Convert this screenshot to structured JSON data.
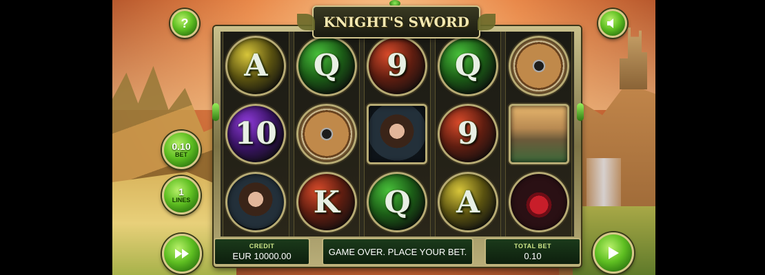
{
  "title": "KNIGHT'S SWORD",
  "buttons": {
    "help": "?",
    "bet_value": "0.10",
    "bet_label": "BET",
    "lines_value": "1",
    "lines_label": "LINES"
  },
  "reels": [
    [
      "A",
      "10",
      "princess"
    ],
    [
      "Q",
      "shield",
      "K"
    ],
    [
      "9",
      "princess",
      "Q"
    ],
    [
      "Q",
      "9",
      "A"
    ],
    [
      "shield",
      "castle",
      "gem"
    ]
  ],
  "symbols": {
    "r1": [
      {
        "text": "A",
        "style": "yellow"
      },
      {
        "text": "10",
        "style": "purple"
      },
      {
        "text": "",
        "style": "princess"
      }
    ],
    "r2": [
      {
        "text": "Q",
        "style": "green"
      },
      {
        "text": "",
        "style": "shield"
      },
      {
        "text": "K",
        "style": "red"
      }
    ],
    "r3": [
      {
        "text": "9",
        "style": "red"
      },
      {
        "text": "",
        "style": "princess"
      },
      {
        "text": "Q",
        "style": "green"
      }
    ],
    "r4": [
      {
        "text": "Q",
        "style": "green"
      },
      {
        "text": "9",
        "style": "red"
      },
      {
        "text": "A",
        "style": "yellow"
      }
    ],
    "r5": [
      {
        "text": "",
        "style": "shield"
      },
      {
        "text": "",
        "style": "castle"
      },
      {
        "text": "",
        "style": "gem"
      }
    ]
  },
  "panel": {
    "credit_label": "CREDIT",
    "credit_value": "EUR 10000.00",
    "message": "GAME OVER. PLACE YOUR BET.",
    "total_bet_label": "TOTAL BET",
    "total_bet_value": "0.10"
  },
  "icons": {
    "help": "question-icon",
    "sound": "speaker-icon",
    "autoplay": "fast-forward-icon",
    "spin": "play-icon"
  }
}
